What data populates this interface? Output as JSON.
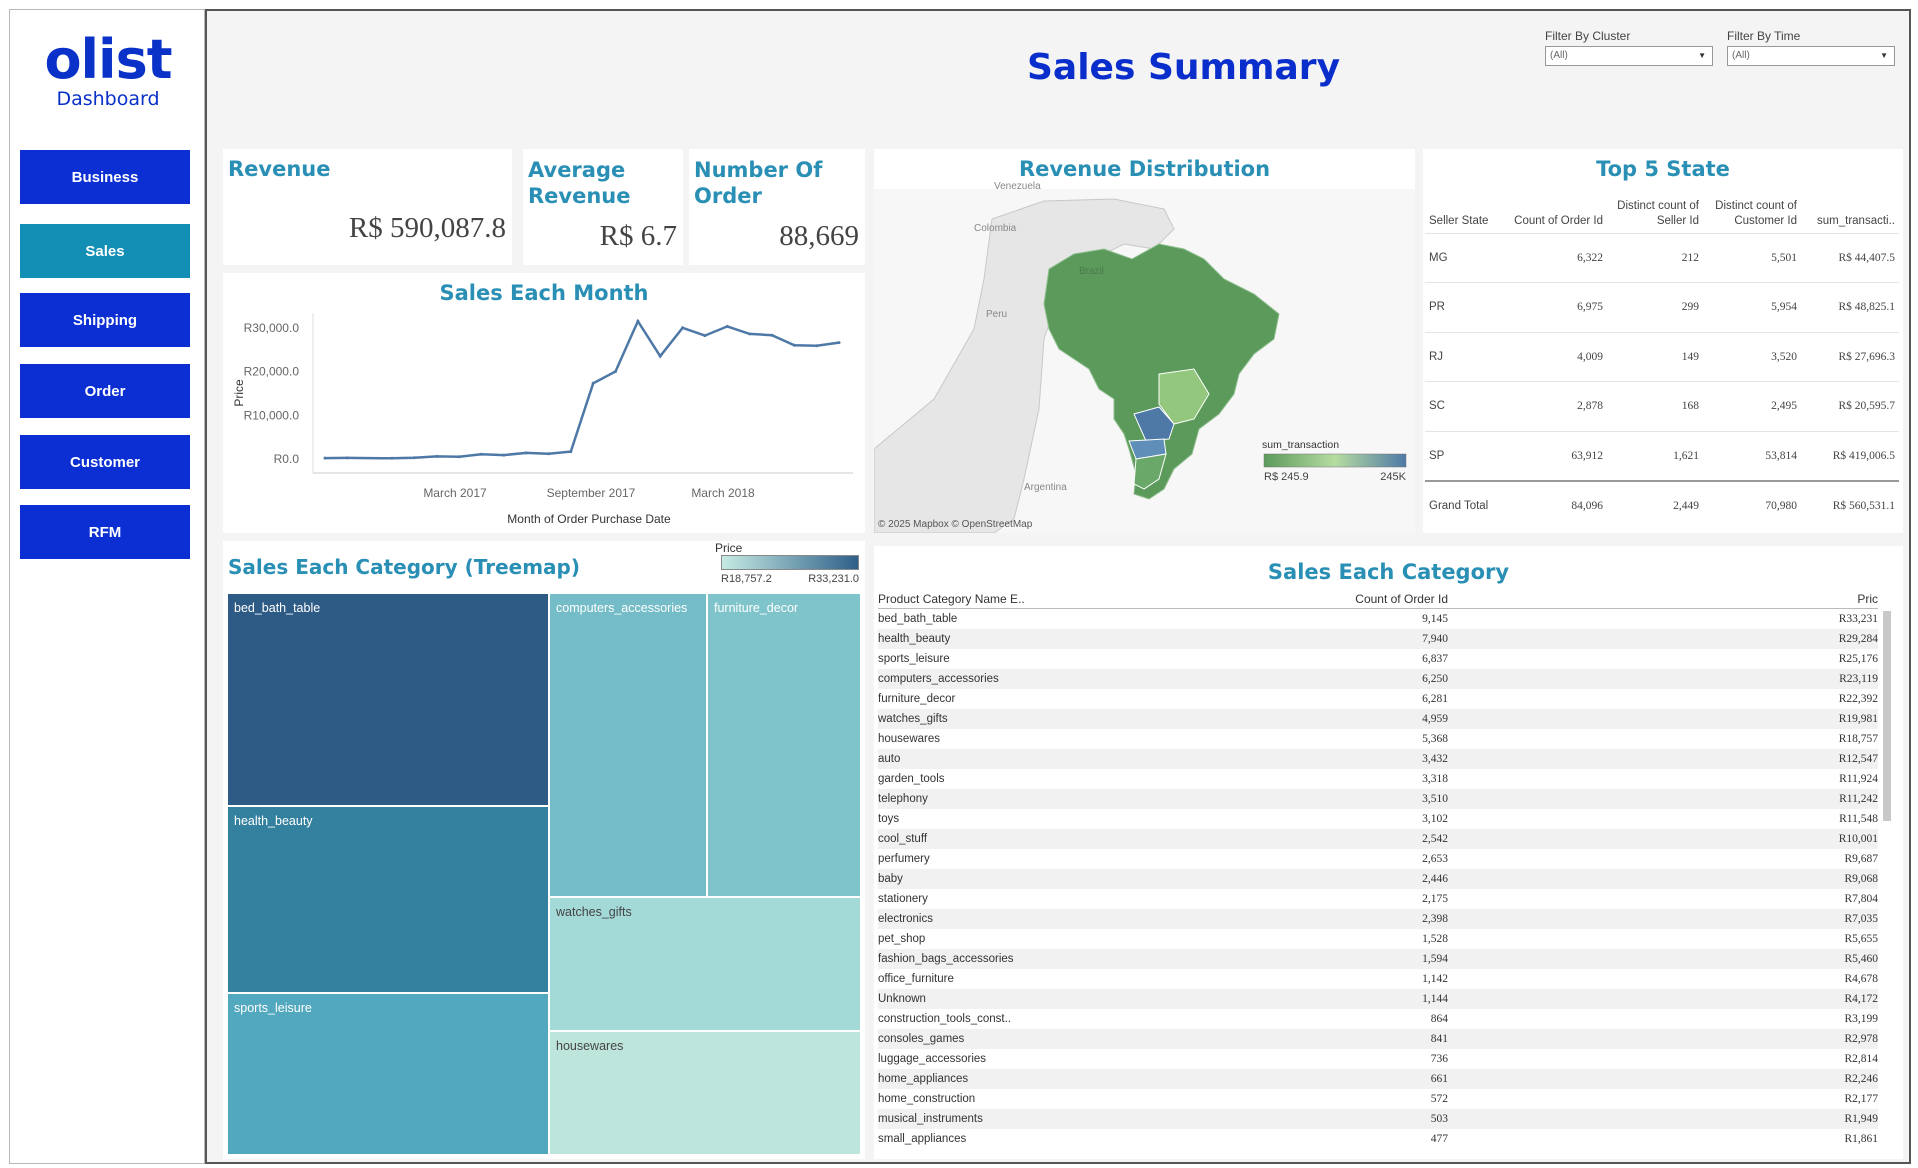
{
  "brand": {
    "logo": "olist",
    "subtitle": "Dashboard"
  },
  "nav": [
    {
      "label": "Business",
      "active": false
    },
    {
      "label": "Sales",
      "active": true
    },
    {
      "label": "Shipping",
      "active": false
    },
    {
      "label": "Order",
      "active": false
    },
    {
      "label": "Customer",
      "active": false
    },
    {
      "label": "RFM",
      "active": false
    }
  ],
  "colors": {
    "nav_default": "#0b2fd3",
    "nav_active": "#138fb6",
    "title": "#0a2ecc",
    "card_title": "#2a8fb5",
    "line": "#4e79a7"
  },
  "page_title": "Sales Summary",
  "filters": [
    {
      "label": "Filter By Cluster",
      "value": "(All)"
    },
    {
      "label": "Filter By Time",
      "value": "(All)"
    }
  ],
  "kpis": {
    "revenue": {
      "title": "Revenue",
      "value": "R$ 590,087.8"
    },
    "avg": {
      "title_1": "Average",
      "title_2": "Revenue",
      "value": "R$ 6.7"
    },
    "orders": {
      "title_1": "Number Of",
      "title_2": "Order",
      "value": "88,669"
    }
  },
  "line_chart": {
    "title": "Sales Each Month",
    "ylabel": "Price",
    "xlabel": "Month of Order Purchase Date",
    "yticks": [
      "R0.0",
      "R10,000.0",
      "R20,000.0",
      "R30,000.0"
    ],
    "xticks": [
      "March 2017",
      "September 2017",
      "March 2018"
    ]
  },
  "map": {
    "title": "Revenue Distribution",
    "labels": {
      "venezuela": "Venezuela",
      "colombia": "Colombia",
      "peru": "Peru",
      "brazil": "Brazil",
      "argentina": "Argentina"
    },
    "legend_title": "sum_transaction",
    "legend_min": "R$ 245.9",
    "legend_max": "245K",
    "attribution": "© 2025 Mapbox  © OpenStreetMap"
  },
  "top_states": {
    "title": "Top 5 State",
    "headers": [
      "Seller State",
      "Count of Order Id",
      "Distinct count of Seller Id",
      "Distinct count of Customer Id",
      "sum_transacti.."
    ],
    "rows": [
      [
        "MG",
        "6,322",
        "212",
        "5,501",
        "R$ 44,407.5"
      ],
      [
        "PR",
        "6,975",
        "299",
        "5,954",
        "R$ 48,825.1"
      ],
      [
        "RJ",
        "4,009",
        "149",
        "3,520",
        "R$ 27,696.3"
      ],
      [
        "SC",
        "2,878",
        "168",
        "2,495",
        "R$ 20,595.7"
      ],
      [
        "SP",
        "63,912",
        "1,621",
        "53,814",
        "R$ 419,006.5"
      ]
    ],
    "grand_total": [
      "Grand Total",
      "84,096",
      "2,449",
      "70,980",
      "R$ 560,531.1"
    ]
  },
  "treemap": {
    "title": "Sales Each Category (Treemap)",
    "legend_title": "Price",
    "legend_min": "R18,757.2",
    "legend_max": "R33,231.0",
    "cells": [
      "bed_bath_table",
      "health_beauty",
      "sports_leisure",
      "computers_accessories",
      "furniture_decor",
      "watches_gifts",
      "housewares"
    ]
  },
  "category_table": {
    "title": "Sales Each Category",
    "headers": [
      "Product Category Name E..",
      "Count of Order Id",
      "Pric"
    ],
    "rows": [
      [
        "bed_bath_table",
        "9,145",
        "R33,231"
      ],
      [
        "health_beauty",
        "7,940",
        "R29,284"
      ],
      [
        "sports_leisure",
        "6,837",
        "R25,176"
      ],
      [
        "computers_accessories",
        "6,250",
        "R23,119"
      ],
      [
        "furniture_decor",
        "6,281",
        "R22,392"
      ],
      [
        "watches_gifts",
        "4,959",
        "R19,981"
      ],
      [
        "housewares",
        "5,368",
        "R18,757"
      ],
      [
        "auto",
        "3,432",
        "R12,547"
      ],
      [
        "garden_tools",
        "3,318",
        "R11,924"
      ],
      [
        "telephony",
        "3,510",
        "R11,242"
      ],
      [
        "toys",
        "3,102",
        "R11,548"
      ],
      [
        "cool_stuff",
        "2,542",
        "R10,001"
      ],
      [
        "perfumery",
        "2,653",
        "R9,687"
      ],
      [
        "baby",
        "2,446",
        "R9,068"
      ],
      [
        "stationery",
        "2,175",
        "R7,804"
      ],
      [
        "electronics",
        "2,398",
        "R7,035"
      ],
      [
        "pet_shop",
        "1,528",
        "R5,655"
      ],
      [
        "fashion_bags_accessories",
        "1,594",
        "R5,460"
      ],
      [
        "office_furniture",
        "1,142",
        "R4,678"
      ],
      [
        "Unknown",
        "1,144",
        "R4,172"
      ],
      [
        "construction_tools_const..",
        "864",
        "R3,199"
      ],
      [
        "consoles_games",
        "841",
        "R2,978"
      ],
      [
        "luggage_accessories",
        "736",
        "R2,814"
      ],
      [
        "home_appliances",
        "661",
        "R2,246"
      ],
      [
        "home_construction",
        "572",
        "R2,177"
      ],
      [
        "musical_instruments",
        "503",
        "R1,949"
      ],
      [
        "small_appliances",
        "477",
        "R1,861"
      ]
    ]
  },
  "chart_data": {
    "type": "line",
    "title": "Sales Each Month",
    "xlabel": "Month of Order Purchase Date",
    "ylabel": "Price",
    "x": [
      "2016-09",
      "2016-10",
      "2016-12",
      "2017-01",
      "2017-02",
      "2017-03",
      "2017-04",
      "2017-05",
      "2017-06",
      "2017-07",
      "2017-08",
      "2017-09",
      "2017-10",
      "2017-11",
      "2017-12",
      "2018-01",
      "2018-02",
      "2018-03",
      "2018-04",
      "2018-05",
      "2018-06",
      "2018-07",
      "2018-08"
    ],
    "values": [
      200,
      250,
      150,
      300,
      600,
      500,
      1100,
      900,
      1400,
      1200,
      1700,
      17300,
      20000,
      31500,
      23500,
      30000,
      28200,
      30300,
      28600,
      28300,
      26000,
      25900,
      26600
    ],
    "ylim": [
      0,
      32000
    ],
    "grid": false
  }
}
